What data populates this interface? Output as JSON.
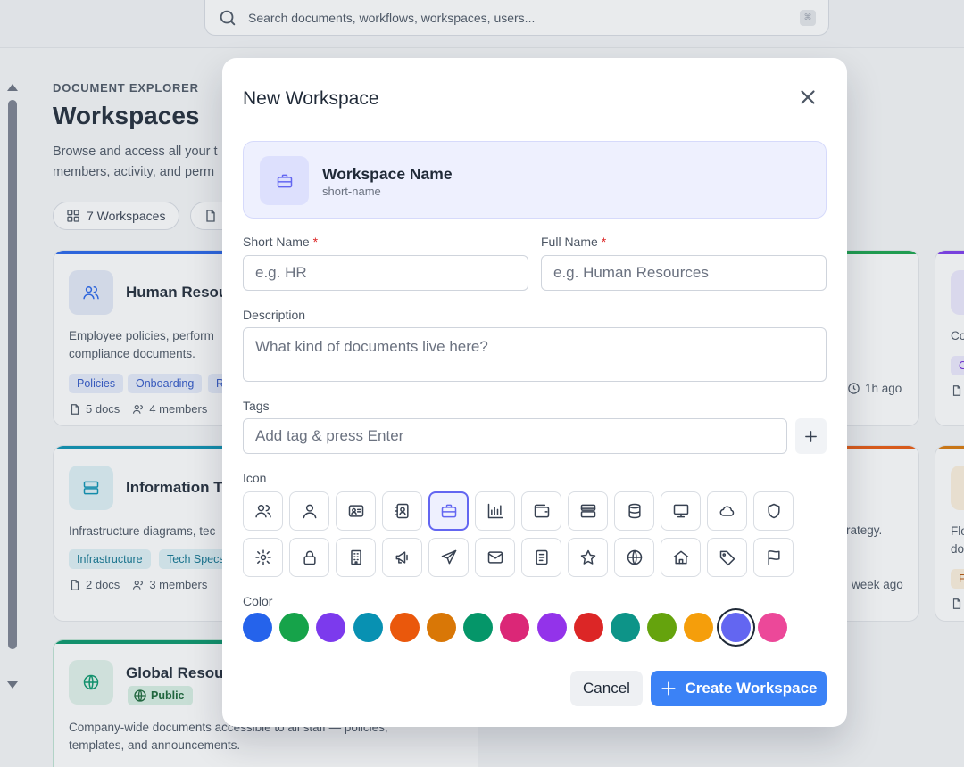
{
  "search": {
    "placeholder": "Search documents, workflows, workspaces, users..."
  },
  "page": {
    "eyebrow": "DOCUMENT EXPLORER",
    "title": "Workspaces",
    "desc_line1": "Browse and access all your t",
    "desc_line2": "members, activity, and perm",
    "count_pill": "7 Workspaces"
  },
  "cards": {
    "hr": {
      "title": "Human Resou",
      "desc1": "Employee policies, perform",
      "desc2": "compliance documents.",
      "tags": [
        "Policies",
        "Onboarding",
        "R"
      ],
      "docs": "5 docs",
      "members": "4 members"
    },
    "it": {
      "title": "Information T",
      "desc1": "Infrastructure diagrams, tec",
      "tags": [
        "Infrastructure",
        "Tech Specs"
      ],
      "docs": "2 docs",
      "members": "3 members"
    },
    "global": {
      "title": "Global Resou",
      "badge": "Public",
      "desc1": "Company-wide documents accessible to all staff — policies,",
      "desc2": "templates, and announcements."
    },
    "right_a": {
      "ago": "1h ago"
    },
    "right_b": {
      "desc": "rategy.",
      "ago": "week ago"
    },
    "far_a": {
      "desc": "Co",
      "tag": "C"
    },
    "far_b": {
      "desc1": "Flo",
      "desc2": "do",
      "tag": "F"
    }
  },
  "modal": {
    "title": "New Workspace",
    "preview_name": "Workspace Name",
    "preview_short": "short-name",
    "short_name_label": "Short Name",
    "short_name_placeholder": "e.g. HR",
    "full_name_label": "Full Name",
    "full_name_placeholder": "e.g. Human Resources",
    "required_mark": "*",
    "description_label": "Description",
    "description_placeholder": "What kind of documents live here?",
    "tags_label": "Tags",
    "tags_placeholder": "Add tag & press Enter",
    "icon_label": "Icon",
    "color_label": "Color",
    "cancel": "Cancel",
    "create": "Create Workspace",
    "selected_icon": "briefcase-icon",
    "selected_color": "#6366f1"
  },
  "icons_row1": [
    "users-icon",
    "user-icon",
    "id-card-icon",
    "contact-book-icon",
    "briefcase-icon",
    "bar-chart-icon",
    "wallet-icon",
    "server-icon",
    "database-icon",
    "monitor-icon",
    "cloud-icon",
    "shield-icon"
  ],
  "icons_row2": [
    "gear-icon",
    "lock-icon",
    "building-icon",
    "megaphone-icon",
    "send-icon",
    "mail-icon",
    "notebook-icon",
    "star-icon",
    "globe-icon",
    "home-icon",
    "tag-icon",
    "flag-icon"
  ],
  "colors": [
    "#2563eb",
    "#16a34a",
    "#7c3aed",
    "#0891b2",
    "#ea580c",
    "#d97706",
    "#059669",
    "#db2777",
    "#9333ea",
    "#dc2626",
    "#0d9488",
    "#65a30d",
    "#f59e0b",
    "#6366f1",
    "#ec4899"
  ]
}
